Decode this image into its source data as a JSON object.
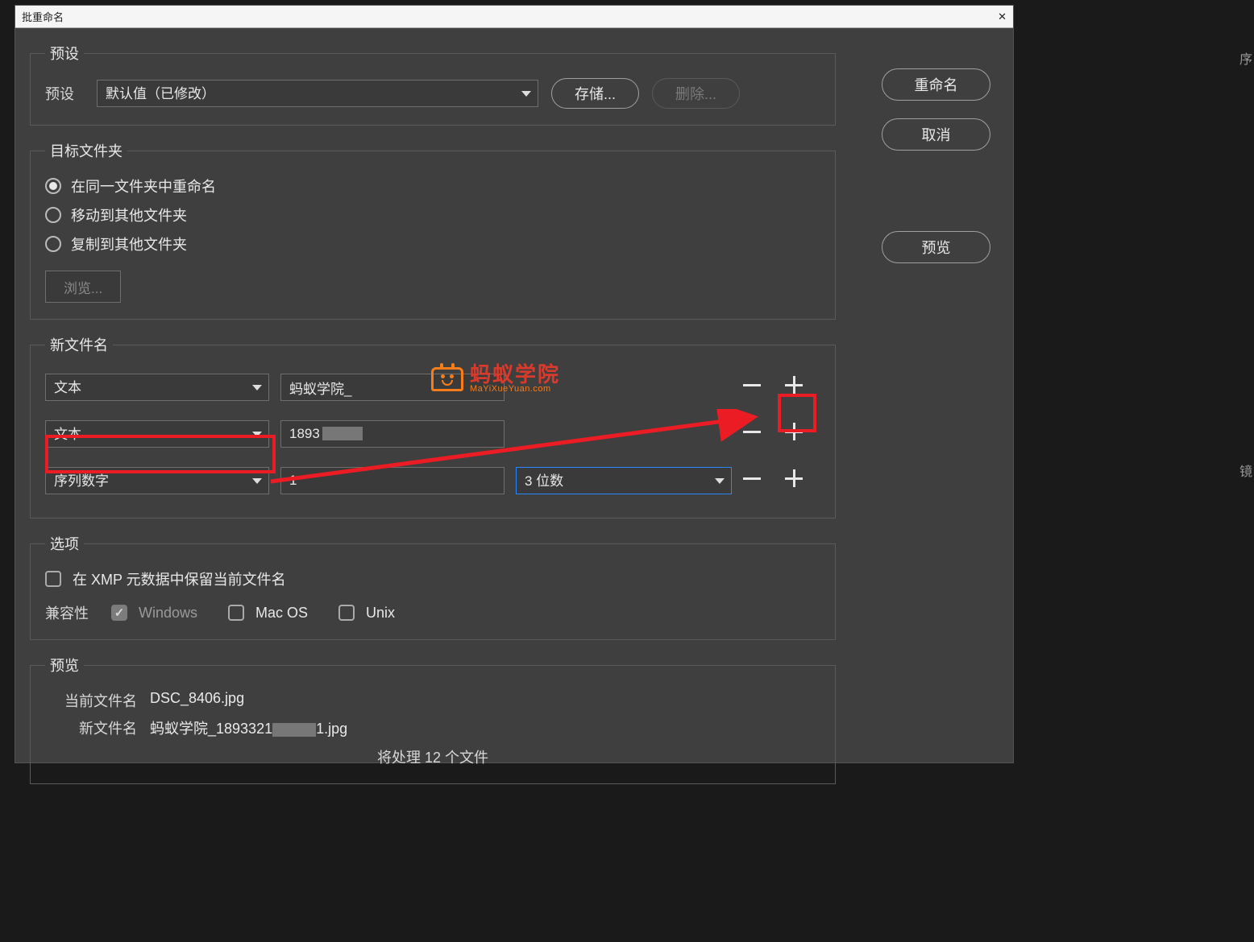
{
  "title": "批重命名",
  "rightButtons": {
    "rename": "重命名",
    "cancel": "取消",
    "preview": "预览"
  },
  "preset": {
    "legend": "预设",
    "label": "预设",
    "value": "默认值（已修改）",
    "saveBtn": "存储...",
    "deleteBtn": "删除..."
  },
  "destination": {
    "legend": "目标文件夹",
    "options": {
      "same": "在同一文件夹中重命名",
      "move": "移动到其他文件夹",
      "copy": "复制到其他文件夹"
    },
    "browse": "浏览..."
  },
  "newFilename": {
    "legend": "新文件名",
    "rows": [
      {
        "type": "文本",
        "value": "蚂蚁学院_"
      },
      {
        "type": "文本",
        "value": "1893"
      },
      {
        "type": "序列数字",
        "value": "1",
        "digits": "3 位数"
      }
    ]
  },
  "options": {
    "legend": "选项",
    "preserveXmp": "在 XMP 元数据中保留当前文件名",
    "compatLabel": "兼容性",
    "compat": {
      "windows": "Windows",
      "mac": "Mac OS",
      "unix": "Unix"
    }
  },
  "preview": {
    "legend": "预览",
    "currentLabel": "当前文件名",
    "currentValue": "DSC_8406.jpg",
    "newLabel": "新文件名",
    "newPrefix": "蚂蚁学院_1893321",
    "newSuffix": "1.jpg",
    "summary": "将处理 12 个文件"
  },
  "watermark": {
    "cn": "蚂蚁学院",
    "en": "MaYiXueYuan.com"
  },
  "edgeChars": {
    "a": "序",
    "b": "镜"
  }
}
